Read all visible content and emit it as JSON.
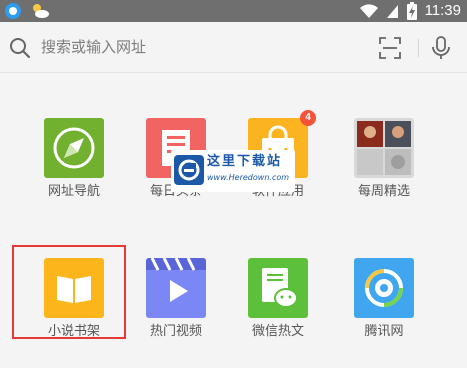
{
  "status_bar": {
    "time": "11:39",
    "icons": [
      "circle-app-icon",
      "weather-icon",
      "wifi-icon",
      "signal-icon",
      "battery-charging-icon"
    ]
  },
  "search": {
    "placeholder": "搜索或输入网址",
    "icons": [
      "search-icon",
      "scan-icon",
      "microphone-icon"
    ]
  },
  "grid": {
    "row1": [
      {
        "label": "网址导航",
        "icon": "compass-icon",
        "color": "#72b12f"
      },
      {
        "label": "每日头条",
        "icon": "news-icon",
        "color": "#f26461"
      },
      {
        "label": "软件应用",
        "icon": "shopping-bag-icon",
        "color": "#fbb41f",
        "badge": "4"
      },
      {
        "label": "每周精选",
        "icon": "photo-collage-icon",
        "color": "#d9d9d9"
      }
    ],
    "row2": [
      {
        "label": "小说书架",
        "icon": "book-icon",
        "color": "#fcb51a",
        "highlighted": true
      },
      {
        "label": "热门视频",
        "icon": "video-icon",
        "color": "#7a87f5"
      },
      {
        "label": "微信热文",
        "icon": "wechat-article-icon",
        "color": "#5dc03b"
      },
      {
        "label": "腾讯网",
        "icon": "tencent-icon",
        "color": "#3fa6ef"
      }
    ]
  },
  "watermark": {
    "title": "这里下载站",
    "url": "www.Heredown.com"
  },
  "colors": {
    "status_bar": "#6f6f6f",
    "background": "#f4f4f4",
    "highlight_border": "#e53935",
    "badge": "#f3533a"
  }
}
